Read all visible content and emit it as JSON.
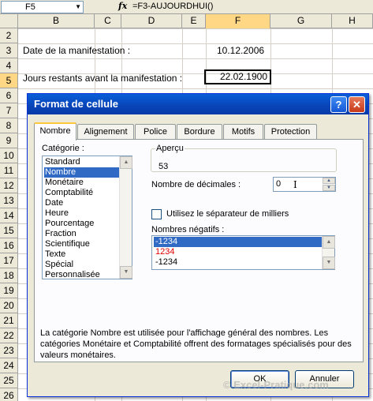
{
  "formula_bar": {
    "name_box": "F5",
    "fx_label": "fx",
    "formula": "=F3-AUJOURDHUI()"
  },
  "sheet": {
    "columns": [
      "B",
      "C",
      "D",
      "E",
      "F",
      "G",
      "H"
    ],
    "selected_column": "F",
    "rows": [
      "2",
      "3",
      "4",
      "5",
      "6",
      "7",
      "8",
      "9",
      "10",
      "11",
      "12",
      "13",
      "14",
      "15",
      "16",
      "17",
      "18",
      "19",
      "20",
      "21",
      "22",
      "23",
      "24",
      "25",
      "26",
      "27"
    ],
    "selected_row": "5",
    "cells": {
      "b3": "Date de la manifestation :",
      "f3": "10.12.2006",
      "b5": "Jours restants avant la manifestation :",
      "f5": "22.02.1900"
    }
  },
  "dialog": {
    "title": "Format de cellule",
    "help": "?",
    "close": "✕",
    "tabs": [
      "Nombre",
      "Alignement",
      "Police",
      "Bordure",
      "Motifs",
      "Protection"
    ],
    "active_tab": "Nombre",
    "category_label": "Catégorie :",
    "categories": [
      "Standard",
      "Nombre",
      "Monétaire",
      "Comptabilité",
      "Date",
      "Heure",
      "Pourcentage",
      "Fraction",
      "Scientifique",
      "Texte",
      "Spécial",
      "Personnalisée"
    ],
    "selected_category": "Nombre",
    "preview_label": "Aperçu",
    "preview_value": "53",
    "decimals_label": "Nombre de décimales :",
    "decimals_value": "0",
    "thousands_label": "Utilisez le séparateur de milliers",
    "negatives_label": "Nombres négatifs :",
    "negatives": [
      {
        "text": "-1234",
        "selected": true,
        "color": "#000000"
      },
      {
        "text": "1234",
        "selected": false,
        "color": "#e00000"
      },
      {
        "text": "-1234",
        "selected": false,
        "color": "#000000"
      }
    ],
    "description": "La catégorie Nombre est utilisée pour l'affichage général des nombres. Les catégories Monétaire et Comptabilité offrent des formatages spécialisés pour des valeurs monétaires.",
    "ok_label": "OK",
    "cancel_label": "Annuler"
  },
  "watermark": "© Excel-Pratique.com",
  "colors": {
    "titlebar": "#0a5fd8",
    "selection": "#316ac5",
    "active_tab_accent": "#ffc83c",
    "header_highlight": "#ffd785"
  }
}
